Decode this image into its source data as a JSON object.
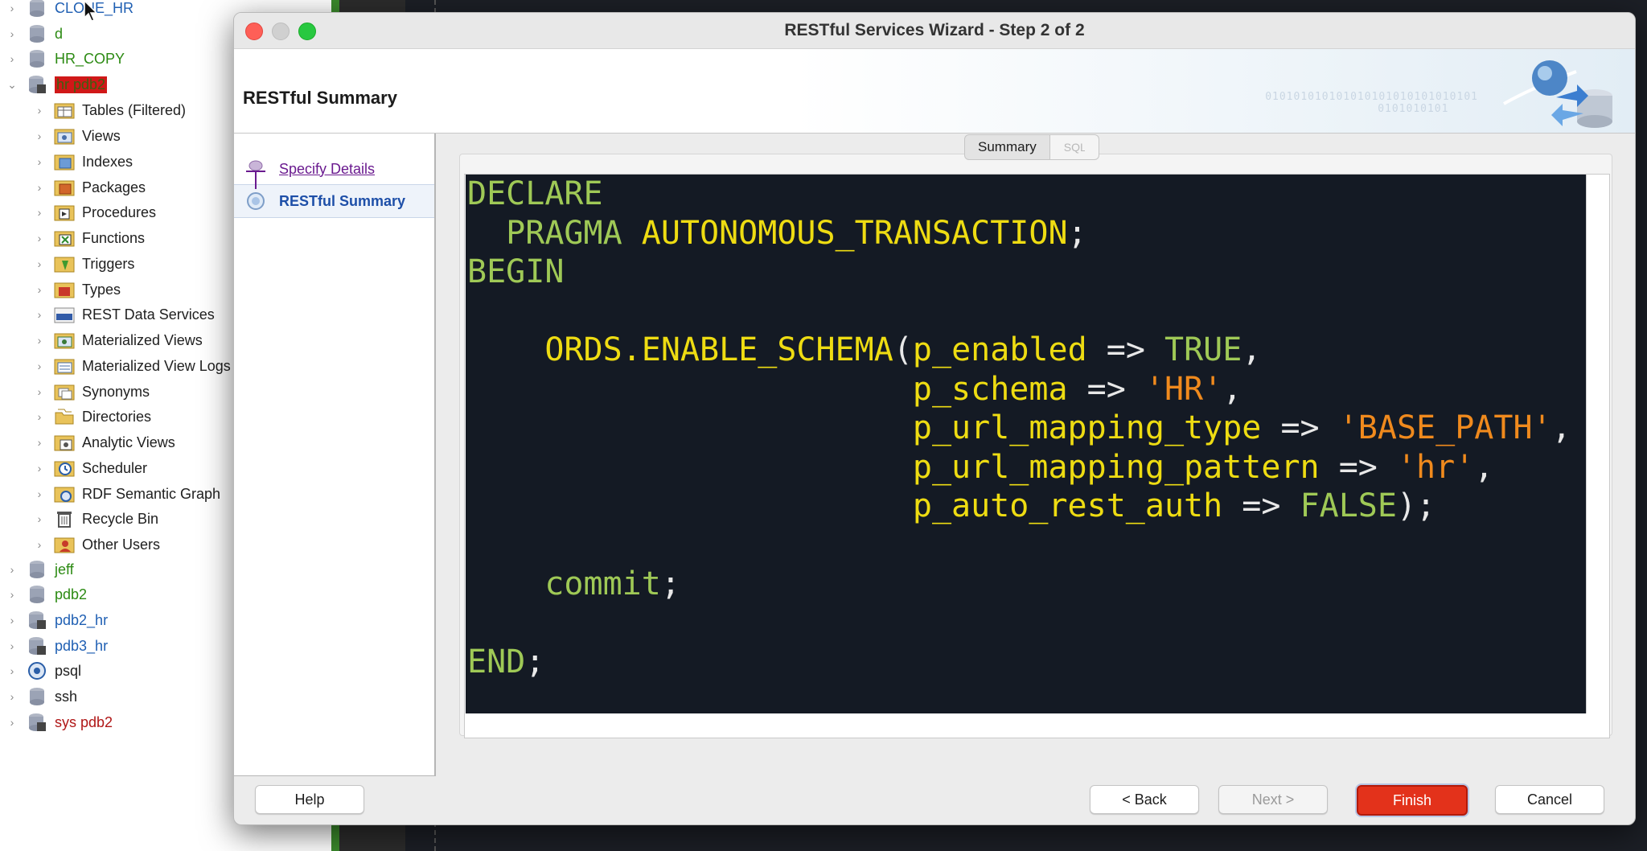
{
  "navigator": {
    "top_items": [
      {
        "label": "CLONE_HR",
        "color": "blue"
      },
      {
        "label": "d",
        "color": "green"
      },
      {
        "label": "HR_COPY",
        "color": "green"
      },
      {
        "label": "hr pdb2",
        "color": "red-highlight"
      }
    ],
    "children": [
      {
        "label": "Tables (Filtered)",
        "icon": "tables-icon"
      },
      {
        "label": "Views",
        "icon": "views-icon"
      },
      {
        "label": "Indexes",
        "icon": "indexes-icon"
      },
      {
        "label": "Packages",
        "icon": "packages-icon"
      },
      {
        "label": "Procedures",
        "icon": "procedures-icon"
      },
      {
        "label": "Functions",
        "icon": "functions-icon"
      },
      {
        "label": "Triggers",
        "icon": "triggers-icon"
      },
      {
        "label": "Types",
        "icon": "types-icon"
      },
      {
        "label": "REST Data Services",
        "icon": "rest-icon"
      },
      {
        "label": "Materialized Views",
        "icon": "materialized-views-icon"
      },
      {
        "label": "Materialized View Logs",
        "icon": "materialized-view-logs-icon"
      },
      {
        "label": "Synonyms",
        "icon": "synonyms-icon"
      },
      {
        "label": "Directories",
        "icon": "directories-icon"
      },
      {
        "label": "Analytic Views",
        "icon": "analytic-views-icon"
      },
      {
        "label": "Scheduler",
        "icon": "scheduler-icon"
      },
      {
        "label": "RDF Semantic Graph",
        "icon": "rdf-icon"
      },
      {
        "label": "Recycle Bin",
        "icon": "recycle-bin-icon"
      },
      {
        "label": "Other Users",
        "icon": "other-users-icon"
      }
    ],
    "bottom_items": [
      {
        "label": "jeff",
        "color": "green"
      },
      {
        "label": "pdb2",
        "color": "green"
      },
      {
        "label": "pdb2_hr",
        "color": "blue"
      },
      {
        "label": "pdb3_hr",
        "color": "blue"
      },
      {
        "label": "psql",
        "color": "black"
      },
      {
        "label": "ssh",
        "color": "black"
      },
      {
        "label": "sys pdb2",
        "color": "red"
      }
    ]
  },
  "dialog": {
    "title": "RESTful Services Wizard - Step 2 of 2",
    "banner_title": "RESTful Summary",
    "banner_binary": "010101010101010101010101010101",
    "banner_binary_2": "0101010101",
    "steps": [
      {
        "label": "Specify Details"
      },
      {
        "label": "RESTful Summary"
      }
    ],
    "tabs": [
      "Summary",
      "SQL"
    ],
    "code": {
      "l1": "DECLARE",
      "l2_kw": "  PRAGMA",
      "l2_rest": " AUTONOMOUS_TRANSACTION",
      "l2_semi": ";",
      "l3": "BEGIN",
      "l5_fn": "    ORDS.ENABLE_SCHEMA",
      "l5_paren": "(",
      "l5_param": "p_enabled",
      "l5_arrow": " => ",
      "l5_val": "TRUE",
      "l5_tail": ",",
      "l6_param": "                       p_schema",
      "l6_arrow": " => ",
      "l6_val": "'HR'",
      "l6_tail": ",",
      "l7_param": "                       p_url_mapping_type",
      "l7_arrow": " => ",
      "l7_val": "'BASE_PATH'",
      "l7_tail": ",",
      "l8_param": "                       p_url_mapping_pattern",
      "l8_arrow": " => ",
      "l8_val": "'hr'",
      "l8_tail": ",",
      "l9_param": "                       p_auto_rest_auth",
      "l9_arrow": " => ",
      "l9_val": "FALSE",
      "l9_tail": ");",
      "l11_kw": "    commit",
      "l11_tail": ";",
      "l13_kw": "END",
      "l13_tail": ";"
    },
    "buttons": {
      "help": "Help",
      "back": "< Back",
      "next": "Next >",
      "finish": "Finish",
      "cancel": "Cancel"
    }
  },
  "colors": {
    "keyword_green": "#9fc956",
    "identifier_yellow": "#eedc12",
    "string_orange": "#f08a1d",
    "editor_bg": "#141a24",
    "finish_red": "#e3321b"
  }
}
